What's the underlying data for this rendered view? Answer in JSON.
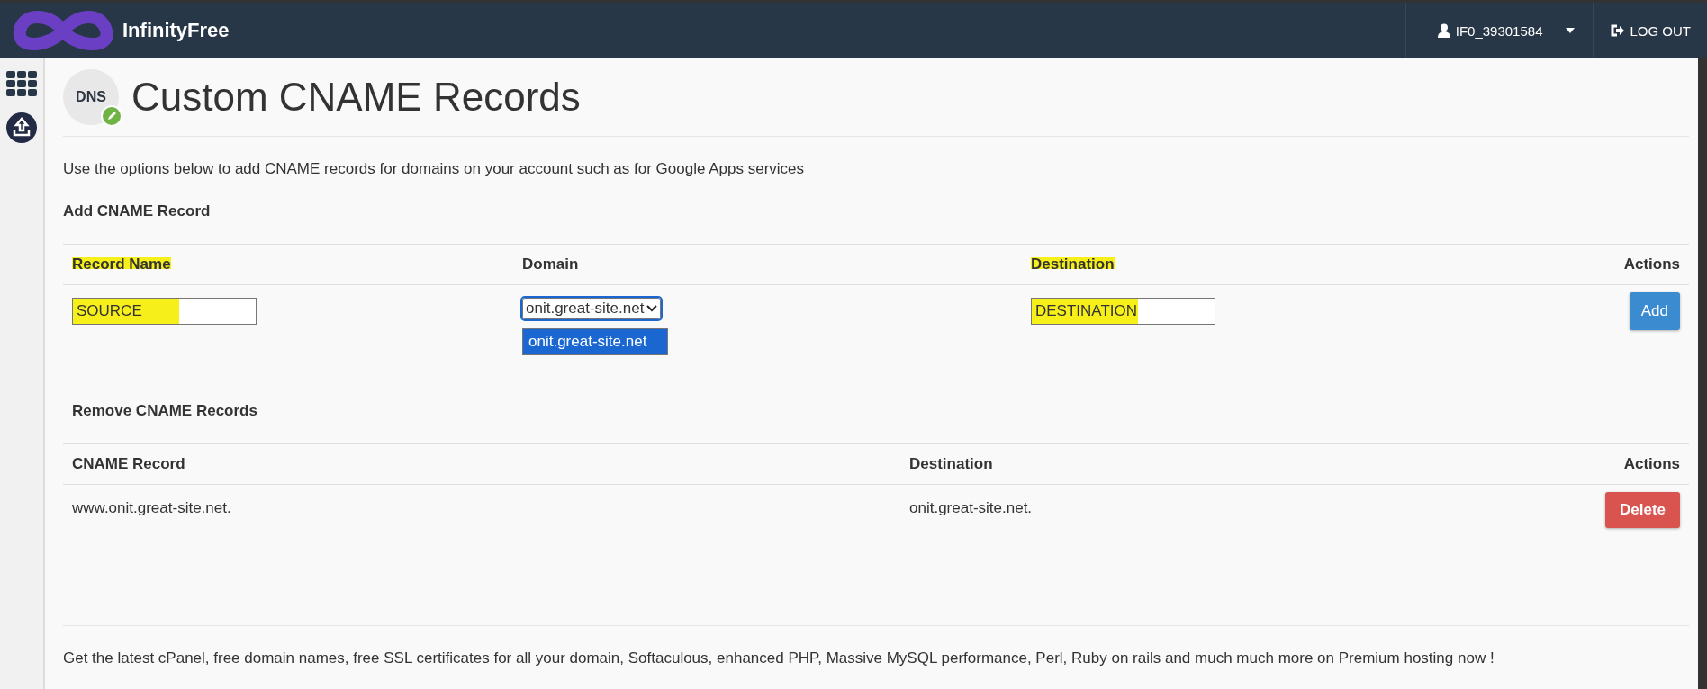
{
  "header": {
    "brand": "InfinityFree",
    "user": "IF0_39301584",
    "logout": "LOG OUT"
  },
  "page": {
    "icon_text": "DNS",
    "title": "Custom CNAME Records",
    "description": "Use the options below to add CNAME records for domains on your account such as for Google Apps services"
  },
  "add_form": {
    "heading": "Add CNAME Record",
    "columns": [
      {
        "label": "Record Name",
        "highlighted": true
      },
      {
        "label": "Domain",
        "highlighted": false
      },
      {
        "label": "Destination",
        "highlighted": true
      },
      {
        "label": "Actions",
        "highlighted": false
      }
    ],
    "record_name": {
      "value": "SOURCE",
      "highlighted": true
    },
    "domain": {
      "value": "onit.great-site.net",
      "expanded": true,
      "options": [
        {
          "label": "onit.great-site.net",
          "selected": true
        }
      ]
    },
    "destination": {
      "value": "DESTINATION",
      "highlighted": true
    },
    "button": "Add"
  },
  "remove_table": {
    "heading": "Remove CNAME Records",
    "columns": [
      "CNAME Record",
      "Destination",
      "Actions"
    ],
    "rows": [
      {
        "record": "www.onit.great-site.net.",
        "destination": "onit.great-site.net.",
        "button": "Delete"
      }
    ]
  },
  "footer": "Get the latest cPanel, free domain names, free SSL certificates for all your domain, Softaculous, enhanced PHP, Massive MySQL performance, Perl, Ruby on rails and much much more on Premium hosting now !"
}
